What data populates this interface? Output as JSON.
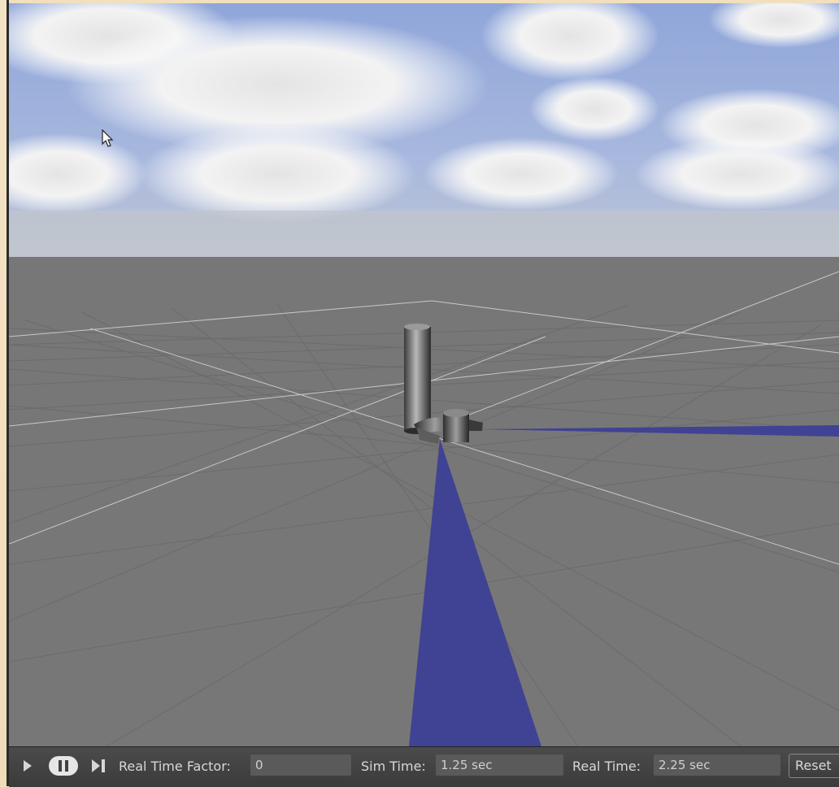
{
  "toolbar": {
    "play_icon": "play-icon",
    "pause_icon": "pause-icon",
    "step_icon": "step-icon",
    "rtf_label": "Real Time Factor:",
    "rtf_value": "0",
    "sim_label": "Sim Time:",
    "sim_value": "1.25 sec",
    "real_label": "Real Time:",
    "real_value": "2.25 sec",
    "reset_label": "Reset"
  },
  "colors": {
    "sky": "#a9b8de",
    "ground": "#777777",
    "laser": "#3d3f96",
    "toolbar": "#404040"
  }
}
